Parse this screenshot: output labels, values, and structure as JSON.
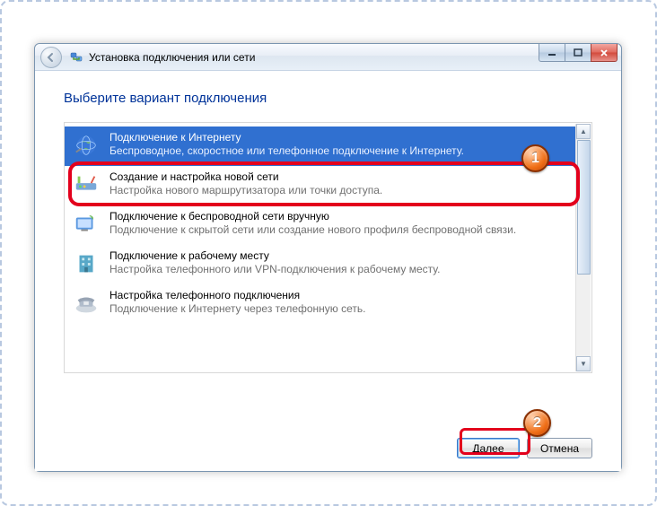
{
  "titlebar": {
    "text": "Установка подключения или сети"
  },
  "heading": "Выберите вариант подключения",
  "options": [
    {
      "title": "Подключение к Интернету",
      "desc": "Беспроводное, скоростное или телефонное подключение к Интернету."
    },
    {
      "title": "Создание и настройка новой сети",
      "desc": "Настройка нового маршрутизатора или точки доступа."
    },
    {
      "title": "Подключение к беспроводной сети вручную",
      "desc": "Подключение к скрытой сети или создание нового профиля беспроводной связи."
    },
    {
      "title": "Подключение к рабочему месту",
      "desc": "Настройка телефонного или VPN-подключения к рабочему месту."
    },
    {
      "title": "Настройка телефонного подключения",
      "desc": "Подключение к Интернету через телефонную сеть."
    }
  ],
  "buttons": {
    "next": "Далее",
    "cancel": "Отмена"
  },
  "markers": {
    "one": "1",
    "two": "2"
  }
}
